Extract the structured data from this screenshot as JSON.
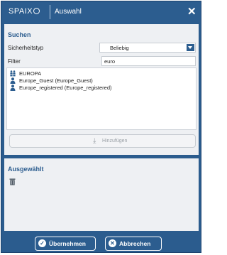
{
  "window": {
    "logo_text": "SPAIX",
    "title": "Auswahl",
    "close_glyph": "✕"
  },
  "search": {
    "section_title": "Suchen",
    "security_type_label": "Sicherheitstyp",
    "security_type_value": "Beliebig",
    "filter_label": "Filter",
    "filter_value": "euro"
  },
  "results": [
    {
      "icon": "group-icon",
      "label": "EUROPA"
    },
    {
      "icon": "user-icon",
      "label": "Europe_Guest  (Europe_Guest)"
    },
    {
      "icon": "user-icon",
      "label": "Europe_registered  (Europe_registered)"
    }
  ],
  "add_button": {
    "label": "Hinzufügen",
    "icon": "add-down-arrow-icon"
  },
  "selected": {
    "section_title": "Ausgewählt",
    "delete_icon": "trash-icon"
  },
  "footer": {
    "ok_label": "Übernehmen",
    "ok_icon": "check-circle-icon",
    "cancel_label": "Abbrechen",
    "cancel_icon": "x-circle-icon"
  },
  "colors": {
    "accent": "#2c5d8f",
    "panel": "#eef0f3"
  }
}
